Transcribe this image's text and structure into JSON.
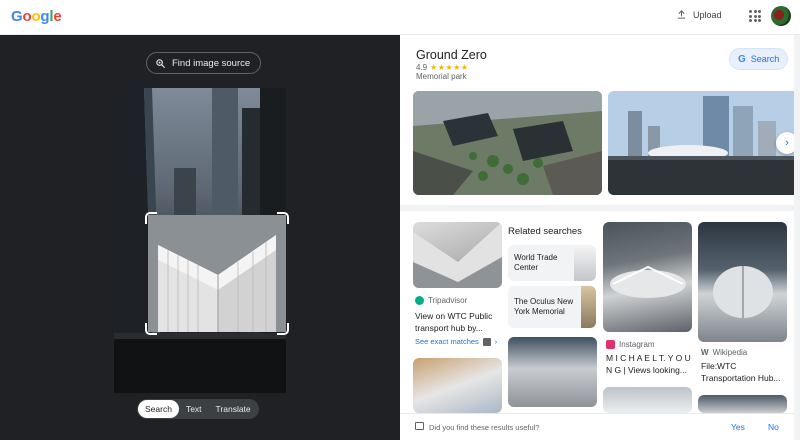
{
  "header": {
    "logo_letters": [
      {
        "ch": "G",
        "color": "#4285F4"
      },
      {
        "ch": "o",
        "color": "#EA4335"
      },
      {
        "ch": "o",
        "color": "#FBBC05"
      },
      {
        "ch": "g",
        "color": "#4285F4"
      },
      {
        "ch": "l",
        "color": "#34A853"
      },
      {
        "ch": "e",
        "color": "#EA4335"
      }
    ],
    "upload_label": "Upload",
    "apps_icon": "apps-grid-icon",
    "avatar_icon": "account-avatar"
  },
  "left_panel": {
    "find_source_label": "Find image source",
    "modes": [
      "Search",
      "Text",
      "Translate"
    ],
    "active_mode": "Search",
    "background": "#202124"
  },
  "knowledge_panel": {
    "title": "Ground Zero",
    "rating": "4.9",
    "stars": "★★★★★",
    "type": "Memorial park",
    "search_label": "Search"
  },
  "results": {
    "related_heading": "Related searches",
    "related": [
      {
        "label": "World Trade Center"
      },
      {
        "label": "The Oculus New York Memorial"
      }
    ],
    "items": [
      {
        "source": "Tripadvisor",
        "title": "View on WTC Public transport hub by...",
        "source_color": "#00AF87"
      },
      {
        "source": "Instagram",
        "title": "M I C H A E L T. Y O U N G | Views looking...",
        "source_color": "#E1306C"
      },
      {
        "source": "Wikipedia",
        "title": "File:WTC Transportation Hub...",
        "source_color": "#5f6368"
      }
    ],
    "exact_matches": "See exact matches"
  },
  "feedback": {
    "question": "Did you find these results useful?",
    "yes": "Yes",
    "no": "No"
  },
  "colors": {
    "accent": "#1a73e8",
    "star": "#f4b400"
  }
}
